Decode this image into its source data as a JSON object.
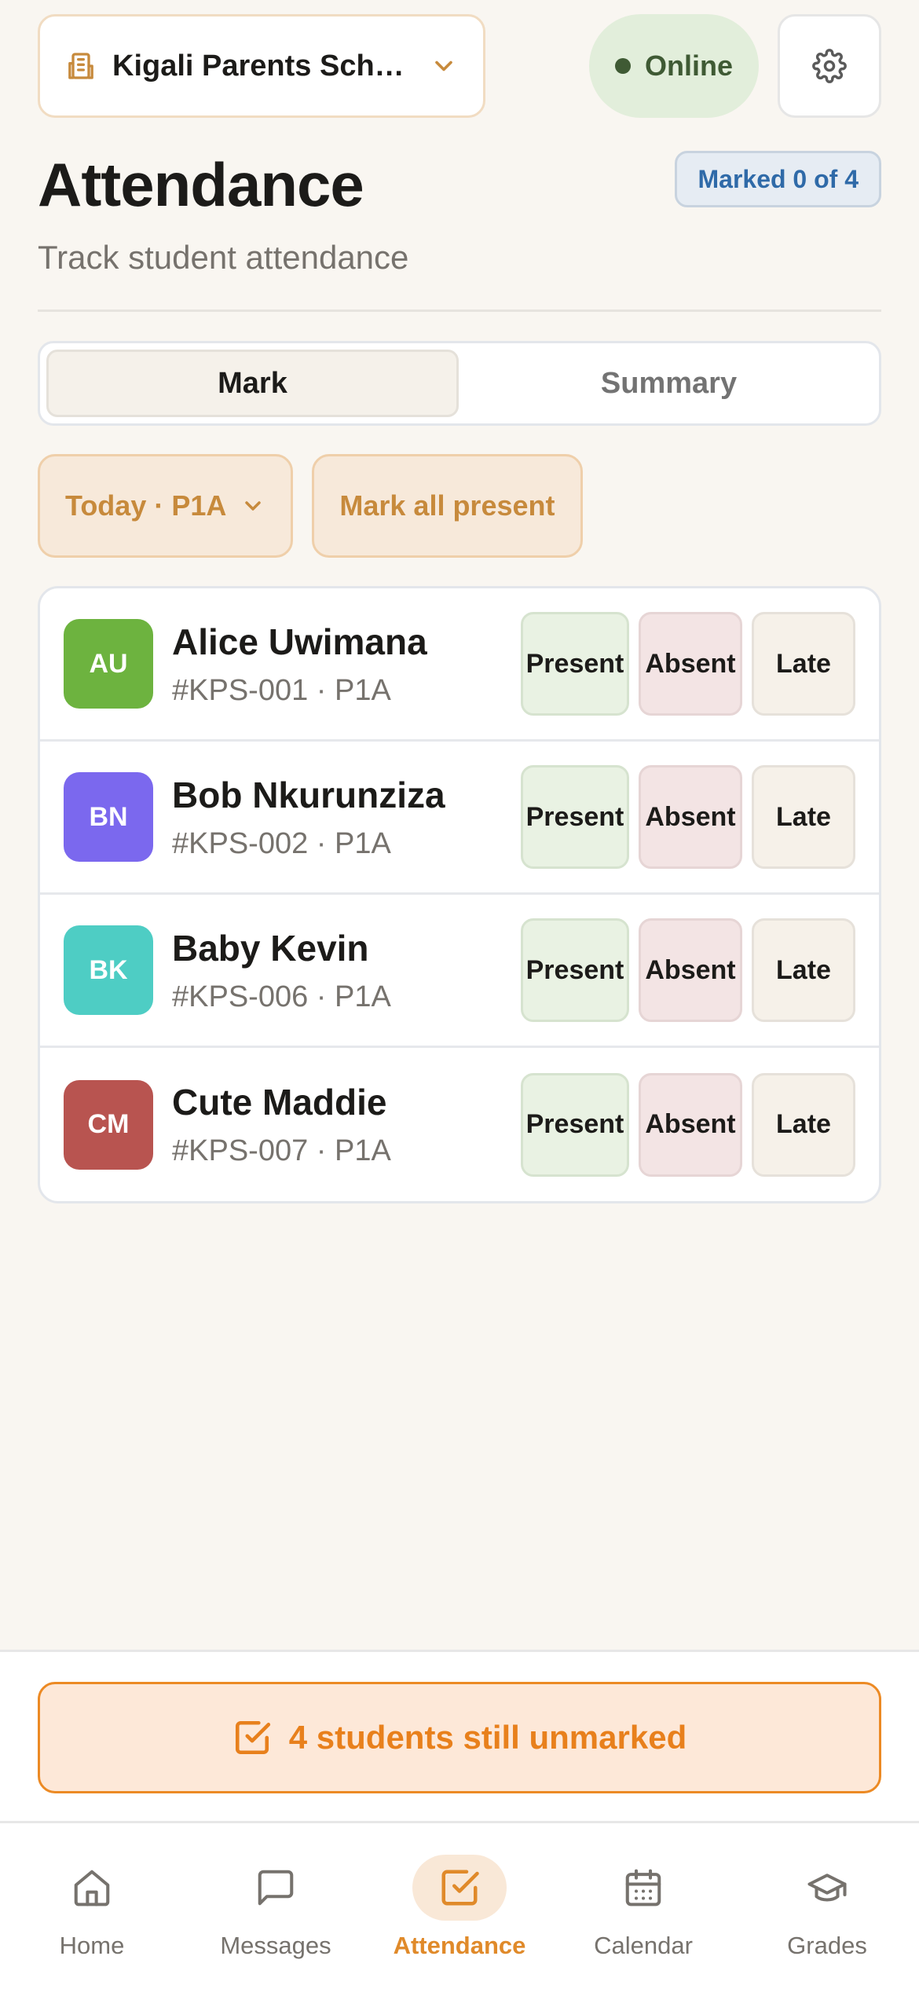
{
  "header": {
    "school_name": "Kigali Parents Sch…",
    "status": "Online",
    "colors": {
      "accent": "#e08a2a",
      "online": "#3f5a34",
      "badge_text": "#2f6aa8"
    }
  },
  "page": {
    "title": "Attendance",
    "subtitle": "Track student attendance",
    "marked_badge": "Marked 0 of 4"
  },
  "tabs": [
    {
      "label": "Mark",
      "active": true
    },
    {
      "label": "Summary",
      "active": false
    }
  ],
  "filters": {
    "date_class": "Today · P1A",
    "mark_all": "Mark all present"
  },
  "status_labels": {
    "present": "Present",
    "absent": "Absent",
    "late": "Late"
  },
  "students": [
    {
      "initials": "AU",
      "name": "Alice Uwimana",
      "meta": "#KPS-001 · P1A",
      "color": "#6db33f"
    },
    {
      "initials": "BN",
      "name": "Bob Nkurunziza",
      "meta": "#KPS-002 · P1A",
      "color": "#7b68ee"
    },
    {
      "initials": "BK",
      "name": "Baby Kevin",
      "meta": "#KPS-006 · P1A",
      "color": "#4ecdc4"
    },
    {
      "initials": "CM",
      "name": "Cute Maddie",
      "meta": "#KPS-007 · P1A",
      "color": "#b85450"
    }
  ],
  "banner": {
    "text": "4 students still unmarked"
  },
  "nav": [
    {
      "label": "Home",
      "icon": "home-icon",
      "active": false
    },
    {
      "label": "Messages",
      "icon": "message-icon",
      "active": false
    },
    {
      "label": "Attendance",
      "icon": "checkbox-icon",
      "active": true
    },
    {
      "label": "Calendar",
      "icon": "calendar-icon",
      "active": false
    },
    {
      "label": "Grades",
      "icon": "graduation-cap-icon",
      "active": false
    }
  ]
}
